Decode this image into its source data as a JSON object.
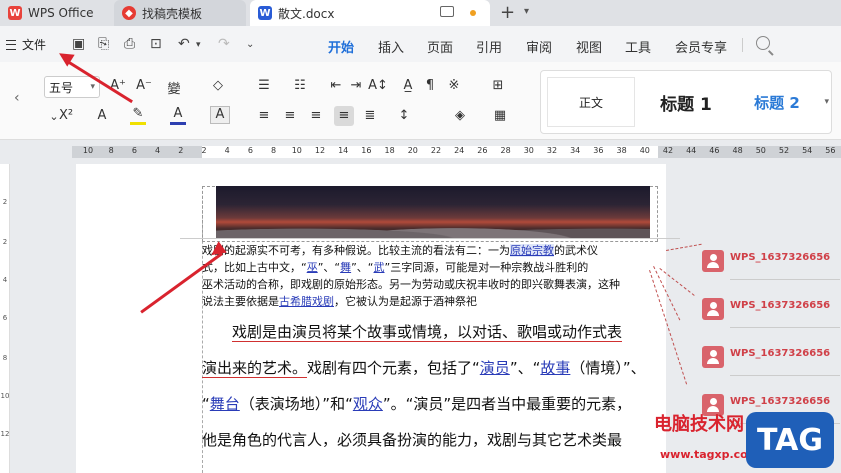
{
  "tabs": {
    "wps": "WPS Office",
    "template": "找稿壳模板",
    "doc": "散文.docx",
    "close": "×",
    "new_tab": "+"
  },
  "menubar": {
    "file": "文件",
    "tabs": [
      "开始",
      "插入",
      "页面",
      "引用",
      "审阅",
      "视图",
      "工具",
      "会员专享"
    ],
    "active": "开始"
  },
  "ribbon": {
    "font_size": "五号",
    "styles": {
      "normal": "正文",
      "heading1": "标题 1",
      "heading2": "标题 2"
    }
  },
  "ruler": {
    "numbers": [
      "10",
      "8",
      "6",
      "4",
      "2",
      "2",
      "4",
      "6",
      "8",
      "10",
      "12",
      "14",
      "16",
      "18",
      "20",
      "22",
      "24",
      "26",
      "28",
      "30",
      "32",
      "34",
      "36",
      "38",
      "40",
      "42",
      "44",
      "46",
      "48",
      "50",
      "52",
      "54",
      "56"
    ]
  },
  "document": {
    "small_lines": [
      [
        "戏剧的起源实不可考，有多种假说。比较主流的看法有二：一为",
        {
          "t": "原始宗教",
          "c": "linkbox"
        },
        "的武术仪"
      ],
      [
        "式，比如上古中文，“",
        {
          "t": "巫",
          "c": "link"
        },
        "”、“",
        {
          "t": "舞",
          "c": "link"
        },
        "”、“",
        {
          "t": "武",
          "c": "link"
        },
        "”三字同源，可能是对一种宗教战斗胜利的"
      ],
      [
        "巫术活动的合称，即戏剧的原始形态。另一为劳动或庆祝丰收时的即兴歌舞表演，这种"
      ],
      [
        "说法主要依据是",
        {
          "t": "古希腊戏剧",
          "c": "link"
        },
        "，它被认为是起源于酒神祭祀"
      ]
    ],
    "big_lines": [
      [
        "　　",
        {
          "t": "戏剧是由演员将某个故事或情境，以对话、歌唱或动作式表",
          "c": "red-u"
        }
      ],
      [
        {
          "t": "演出来的艺术。",
          "c": "red-u"
        },
        "戏剧有四个元素，包括了“",
        {
          "t": "演员",
          "c": "link"
        },
        "”、“",
        {
          "t": "故事",
          "c": "link"
        },
        "（情境）”、"
      ],
      [
        "“",
        {
          "t": "舞台",
          "c": "link"
        },
        "（表演场地）”和“",
        {
          "t": "观众",
          "c": "link"
        },
        "”。“演员”是四者当中最重要的元素，"
      ],
      [
        "他是角色的代言人，必须具备扮演的能力，戏剧与其它艺术类最"
      ]
    ]
  },
  "comments": [
    {
      "author": "WPS_1637326656"
    },
    {
      "author": "WPS_1637326656"
    },
    {
      "author": "WPS_1637326656"
    },
    {
      "author": "WPS_1637326656"
    }
  ],
  "watermark": {
    "title": "电脑技术网",
    "url": "www.tagxp.com",
    "badge": "TAG"
  },
  "colors": {
    "accent": "#1f6fd9",
    "arrow": "#d9232e",
    "comment_author": "#d04048",
    "link": "#2a3cb8"
  }
}
